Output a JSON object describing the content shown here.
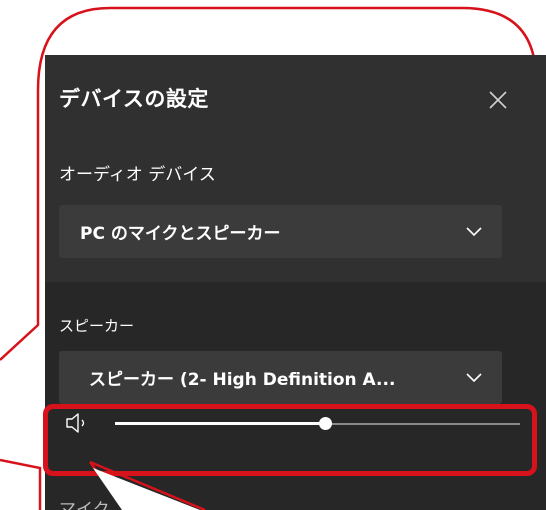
{
  "panel": {
    "title": "デバイスの設定",
    "audio_device": {
      "label": "オーディオ デバイス",
      "selected": "PC のマイクとスピーカー"
    },
    "speaker": {
      "label": "スピーカー",
      "selected": "スピーカー (2- High Definition A..."
    },
    "volume": {
      "level": 0.52
    },
    "next_section_partial": "マイク"
  },
  "icons": {
    "close": "close-icon",
    "chevron": "chevron-down-icon",
    "volume": "speaker-volume-icon"
  },
  "colors": {
    "panel_bg": "#2b2b2b",
    "dropdown_bg": "#3b3b3b",
    "highlight": "#d8121b",
    "bubble_outline": "#d8121b"
  }
}
